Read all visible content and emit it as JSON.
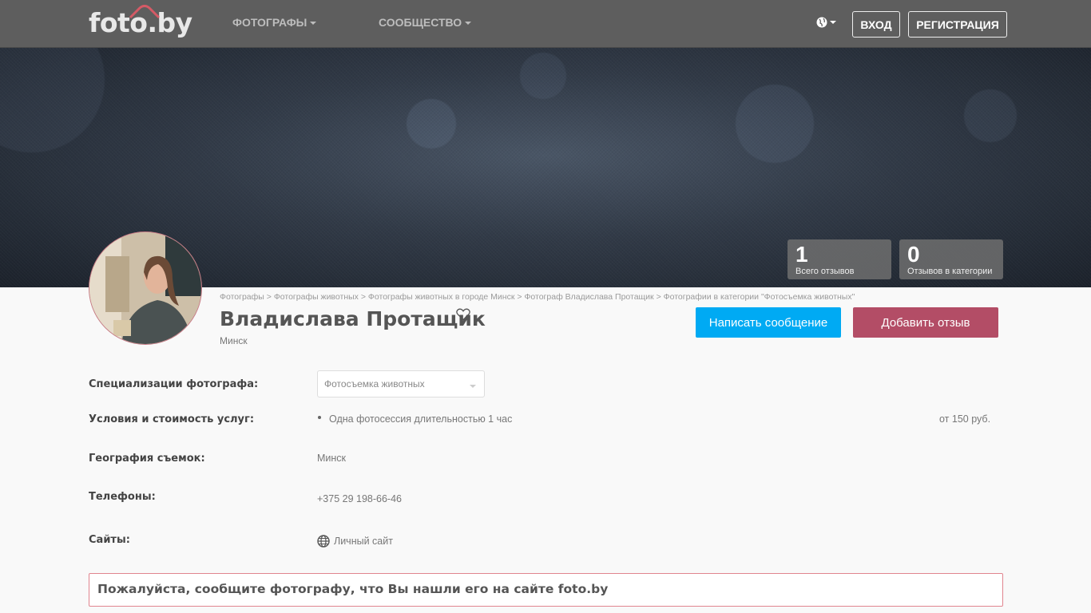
{
  "header": {
    "logo": "foto.by",
    "nav": [
      "ФОТОГРАФЫ",
      "СООБЩЕСТВО"
    ],
    "login": "ВХОД",
    "register": "РЕГИСТРАЦИЯ"
  },
  "stats": [
    {
      "value": "1",
      "label": "Всего отзывов"
    },
    {
      "value": "0",
      "label": "Отзывов в категории"
    }
  ],
  "breadcrumb": [
    "Фотографы",
    "Фотографы животных",
    "Фотографы животных в городе Минск",
    "Фотограф Владислава Протащик",
    "Фотографии в категории \"Фотосъемка животных\""
  ],
  "profile": {
    "name": "Владислава Протащик",
    "city": "Минск"
  },
  "actions": {
    "message": "Написать сообщение",
    "review": "Добавить отзыв"
  },
  "details": {
    "specialization_label": "Специализации фотографа:",
    "specialization_value": "Фотосъемка животных",
    "terms_label": "Условия и стоимость услуг:",
    "terms_item": "Одна фотосессия длительностью 1 час",
    "terms_price": "от 150 руб.",
    "geo_label": "География съемок:",
    "geo_value": "Минск",
    "phones_label": "Телефоны:",
    "phone": "+375 29 198-66-46",
    "sites_label": "Сайты:",
    "site": "Личный сайт"
  },
  "notice": "Пожалуйста, сообщите фотографу, что Вы нашли его на сайте foto.by",
  "colors": {
    "navbar": "#5e5e5e",
    "primary_button": "#00aaf3",
    "review_button": "#b34d66",
    "notice_border": "#e1858f"
  }
}
